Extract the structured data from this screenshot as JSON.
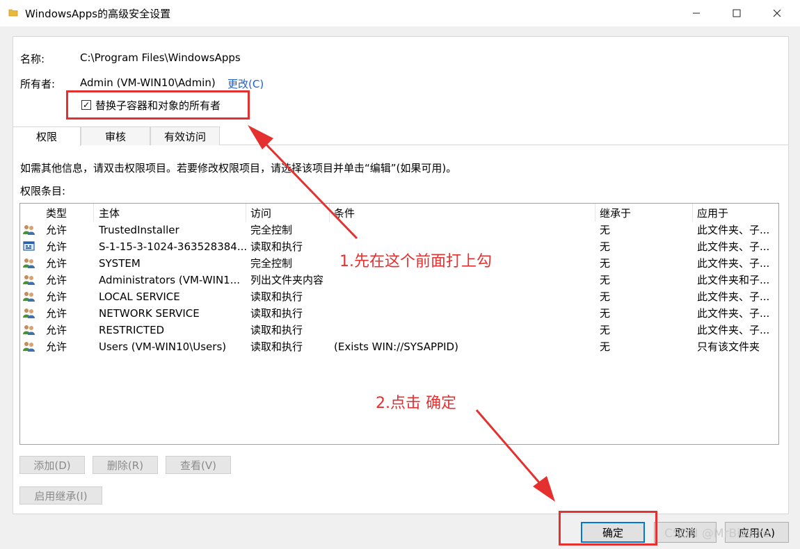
{
  "window": {
    "title": "WindowsApps的高级安全设置",
    "minimize_icon": "minimize-icon",
    "maximize_icon": "maximize-icon",
    "close_icon": "close-icon"
  },
  "general": {
    "name_label": "名称:",
    "name_value": "C:\\Program Files\\WindowsApps",
    "owner_label": "所有者:",
    "owner_value": "Admin (VM-WIN10\\Admin)",
    "change_link": "更改(C)",
    "replace_owner_label": "替换子容器和对象的所有者",
    "replace_owner_checked": true
  },
  "tabs": [
    {
      "label": "权限",
      "active": true
    },
    {
      "label": "审核",
      "active": false
    },
    {
      "label": "有效访问",
      "active": false
    }
  ],
  "permissions": {
    "info_text": "如需其他信息，请双击权限项目。若要修改权限项目，请选择该项目并单击“编辑”(如果可用)。",
    "entries_label": "权限条目:",
    "columns": [
      "类型",
      "主体",
      "访问",
      "条件",
      "继承于",
      "应用于"
    ],
    "rows": [
      {
        "icon": "group-icon",
        "type": "允许",
        "principal": "TrustedInstaller",
        "access": "完全控制",
        "condition": "",
        "inherited": "无",
        "applies": "此文件夹、子..."
      },
      {
        "icon": "app-package-icon",
        "type": "允许",
        "principal": "S-1-15-3-1024-363528384...",
        "access": "读取和执行",
        "condition": "",
        "inherited": "无",
        "applies": "此文件夹、子..."
      },
      {
        "icon": "group-icon",
        "type": "允许",
        "principal": "SYSTEM",
        "access": "完全控制",
        "condition": "",
        "inherited": "无",
        "applies": "此文件夹、子..."
      },
      {
        "icon": "group-icon",
        "type": "允许",
        "principal": "Administrators (VM-WIN1...",
        "access": "列出文件夹内容",
        "condition": "",
        "inherited": "无",
        "applies": "此文件夹和子..."
      },
      {
        "icon": "group-icon",
        "type": "允许",
        "principal": "LOCAL SERVICE",
        "access": "读取和执行",
        "condition": "",
        "inherited": "无",
        "applies": "此文件夹、子..."
      },
      {
        "icon": "group-icon",
        "type": "允许",
        "principal": "NETWORK SERVICE",
        "access": "读取和执行",
        "condition": "",
        "inherited": "无",
        "applies": "此文件夹、子..."
      },
      {
        "icon": "group-icon",
        "type": "允许",
        "principal": "RESTRICTED",
        "access": "读取和执行",
        "condition": "",
        "inherited": "无",
        "applies": "此文件夹、子..."
      },
      {
        "icon": "group-icon",
        "type": "允许",
        "principal": "Users (VM-WIN10\\Users)",
        "access": "读取和执行",
        "condition": "(Exists WIN://SYSAPPID)",
        "inherited": "无",
        "applies": "只有该文件夹"
      }
    ]
  },
  "buttons": {
    "add": "添加(D)",
    "remove": "删除(R)",
    "view": "查看(V)",
    "enable_inheritance": "启用继承(I)",
    "ok": "确定",
    "cancel": "取消",
    "apply": "应用(A)"
  },
  "annotations": {
    "step1": "1.先在这个前面打上勾",
    "step2": "2.点击 确定",
    "highlight_color": "#e53030"
  },
  "watermark": "CSDN @MrBizarre"
}
